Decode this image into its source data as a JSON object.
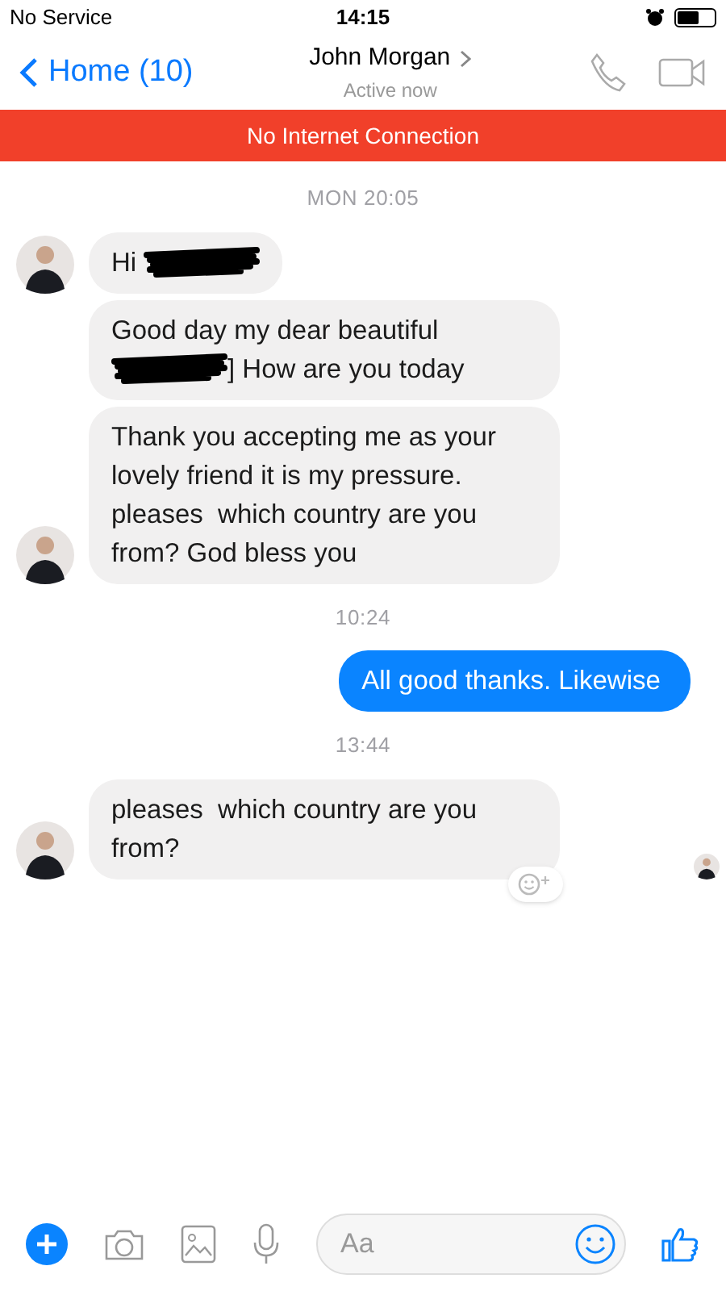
{
  "status_bar": {
    "carrier": "No Service",
    "time": "14:15"
  },
  "nav": {
    "back_label": "Home (10)",
    "contact_name": "John Morgan",
    "presence": "Active now"
  },
  "banner": {
    "text": "No Internet Connection"
  },
  "messages": [
    {
      "kind": "time",
      "text": "MON 20:05"
    },
    {
      "kind": "incoming",
      "avatar": true,
      "reaction_button": false,
      "seen": false,
      "segments": [
        {
          "kind": "text",
          "text": "Hi"
        },
        {
          "kind": "redacted"
        }
      ]
    },
    {
      "kind": "incoming",
      "avatar": false,
      "reaction_button": false,
      "seen": false,
      "segments": [
        {
          "kind": "text",
          "text": "Good day my dear beautiful"
        },
        {
          "kind": "redacted"
        },
        {
          "kind": "text",
          "text": "] How are you today"
        }
      ]
    },
    {
      "kind": "incoming",
      "avatar": true,
      "reaction_button": false,
      "seen": false,
      "segments": [
        {
          "kind": "text",
          "text": "Thank you accepting me as your lovely friend it is my pressure. pleases  which country are you from? God bless you"
        }
      ]
    },
    {
      "kind": "time",
      "text": "10:24"
    },
    {
      "kind": "outgoing",
      "segments": [
        {
          "kind": "text",
          "text": "All good thanks. Likewise"
        }
      ]
    },
    {
      "kind": "time",
      "text": "13:44"
    },
    {
      "kind": "incoming",
      "avatar": true,
      "reaction_button": true,
      "seen": true,
      "segments": [
        {
          "kind": "text",
          "text": "pleases  which country are you from?"
        }
      ]
    }
  ],
  "composer": {
    "placeholder": "Aa"
  }
}
